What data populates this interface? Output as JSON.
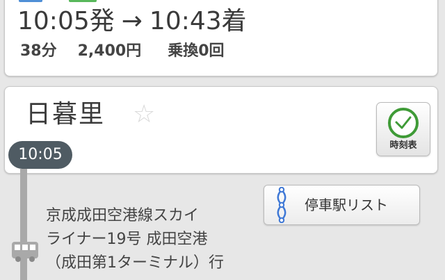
{
  "summary": {
    "departure": "10:05発",
    "arrow": "→",
    "arrival": "10:43着",
    "duration": "38分",
    "fare": "2,400円",
    "transfers": "乗換0回"
  },
  "station": {
    "name": "日暮里",
    "star_icon": "☆",
    "timetable_label": "時刻表",
    "departure_time": "10:05"
  },
  "train": {
    "stop_list_label": "停車駅リスト",
    "line1": "京成成田空港線スカイ",
    "line2": "ライナー19号 成田空港",
    "line3": "（成田第1ターミナル）行"
  },
  "colors": {
    "clock_green": "#3f9b37",
    "badge": "#4f5b63",
    "stops_blue": "#3e78d6",
    "route_gray": "#a9a9a9"
  },
  "icons": {
    "favorite": "star-icon",
    "timetable": "clock-icon",
    "stops": "stops-icon",
    "vehicle": "bus-icon"
  }
}
